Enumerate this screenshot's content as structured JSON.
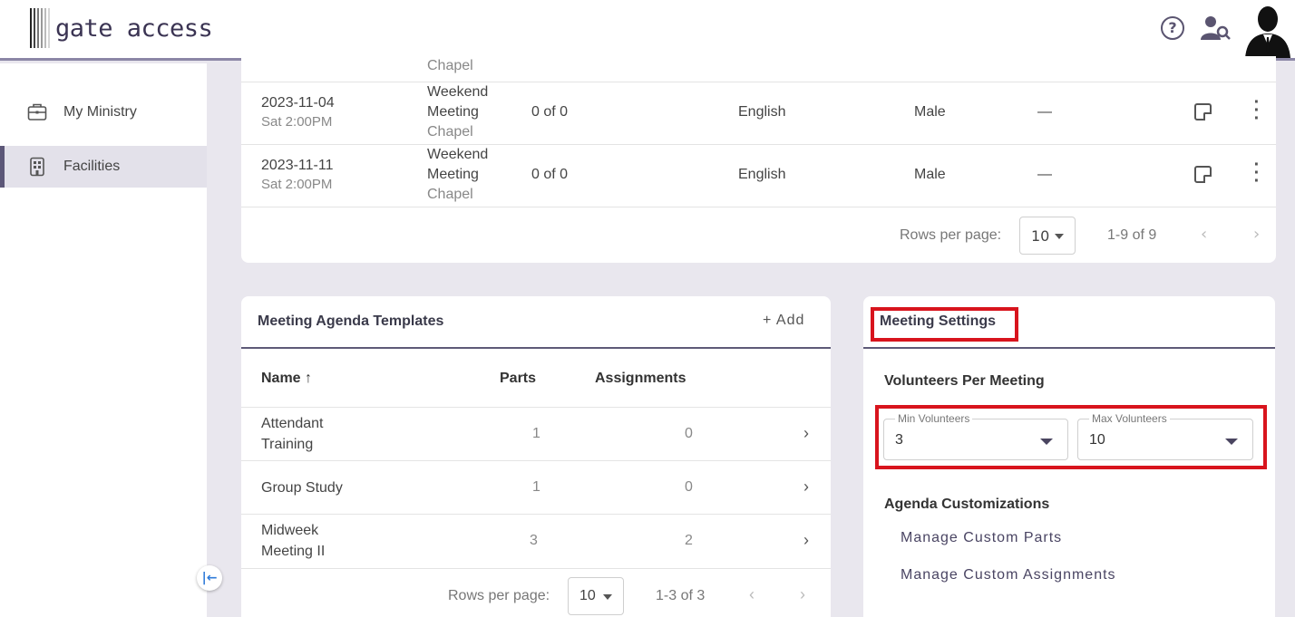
{
  "app": {
    "name": "gate access"
  },
  "header": {
    "help_icon": "help-circle-icon",
    "user_search_icon": "user-search-icon",
    "avatar_icon": "avatar-icon"
  },
  "sidebar": {
    "items": [
      {
        "label": "My Ministry",
        "icon": "briefcase-icon",
        "active": false
      },
      {
        "label": "Facilities",
        "icon": "building-icon",
        "active": true
      }
    ]
  },
  "events": {
    "partial_top": {
      "type_line": "Chapel"
    },
    "rows": [
      {
        "date": "2023-11-04",
        "time": "Sat 2:00PM",
        "type_line1": "Weekend",
        "type_line2": "Meeting",
        "type_line3": "Chapel",
        "count": "0 of 0",
        "language": "English",
        "gender": "Male",
        "extra": "—"
      },
      {
        "date": "2023-11-11",
        "time": "Sat 2:00PM",
        "type_line1": "Weekend",
        "type_line2": "Meeting",
        "type_line3": "Chapel",
        "count": "0 of 0",
        "language": "English",
        "gender": "Male",
        "extra": "—"
      }
    ],
    "pager": {
      "rows_per_page_label": "Rows per page:",
      "rows_per_page": "10",
      "range": "1-9 of 9"
    }
  },
  "templates": {
    "title": "Meeting Agenda Templates",
    "add_label": "+ Add",
    "columns": {
      "name": "Name ↑",
      "parts": "Parts",
      "assignments": "Assignments"
    },
    "rows": [
      {
        "name_line1": "Attendant",
        "name_line2": "Training",
        "parts": "1",
        "assignments": "0"
      },
      {
        "name_line1": "Group Study",
        "name_line2": "",
        "parts": "1",
        "assignments": "0"
      },
      {
        "name_line1": "Midweek",
        "name_line2": "Meeting II",
        "parts": "3",
        "assignments": "2"
      }
    ],
    "pager": {
      "rows_per_page_label": "Rows per page:",
      "rows_per_page": "10",
      "range": "1-3 of 3"
    }
  },
  "settings": {
    "title": "Meeting Settings",
    "volunteers_heading": "Volunteers Per Meeting",
    "min": {
      "label": "Min Volunteers",
      "value": "3"
    },
    "max": {
      "label": "Max Volunteers",
      "value": "10"
    },
    "agenda_heading": "Agenda Customizations",
    "links": [
      "Manage Custom Parts",
      "Manage Custom Assignments"
    ]
  },
  "colors": {
    "accent": "#5e5a78",
    "highlight": "#d8141d",
    "background": "#e9e7ee"
  }
}
